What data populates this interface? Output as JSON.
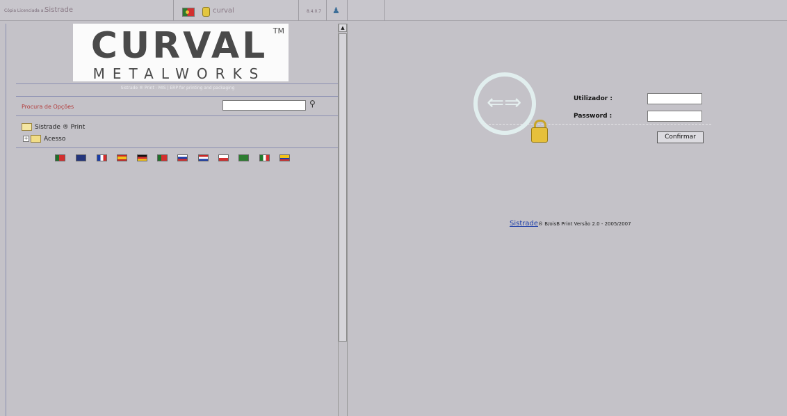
{
  "topbar": {
    "licensed_label": "Cópia Licenciada a:",
    "licensed_name": "Sistrade",
    "database": "curval",
    "version": "8.4.0.7"
  },
  "left": {
    "logo_word": "CURVAL",
    "logo_tm": "TM",
    "logo_sub": "METALWORKS",
    "tagline": "Sistrade ® Print - MIS | ERP for printing and packaging",
    "search_label": "Procura de Opções",
    "search_placeholder": "",
    "tree": [
      {
        "label": "Sistrade ® Print"
      },
      {
        "label": "Acesso",
        "expander": "+"
      }
    ],
    "languages": [
      "pt",
      "en",
      "fr",
      "es",
      "de",
      "br",
      "si",
      "nl",
      "pl",
      "sa",
      "it",
      "ec"
    ]
  },
  "login": {
    "user_label": "Utilizador :",
    "password_label": "Password :",
    "user_value": "",
    "password_value": "",
    "confirm_label": "Confirmar"
  },
  "footer": {
    "link": "Sistrade",
    "text": "® B/oisB Print Versão 2.0 - 2005/2007"
  },
  "colors": {
    "background": "#c4c2c8",
    "accent_red": "#b23a3a",
    "link_blue": "#1d3fa8"
  }
}
